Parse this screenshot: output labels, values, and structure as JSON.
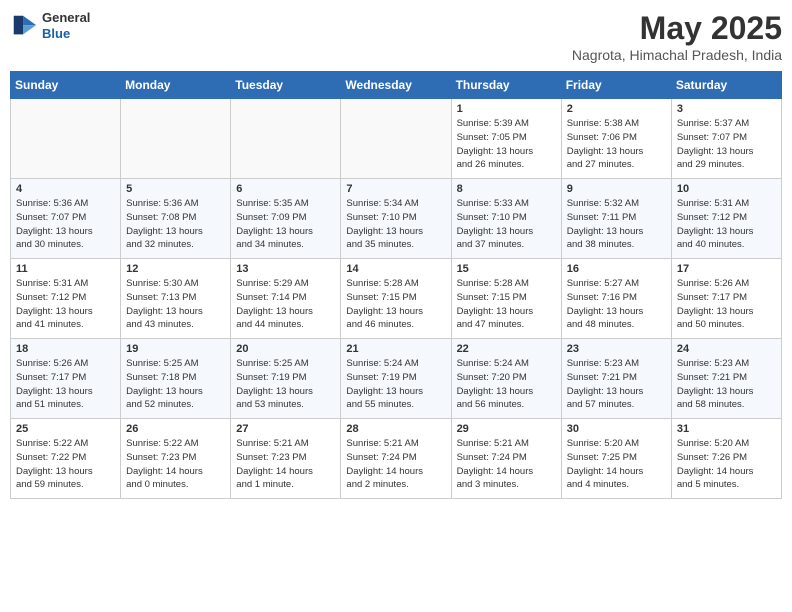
{
  "header": {
    "logo_general": "General",
    "logo_blue": "Blue",
    "month_title": "May 2025",
    "location": "Nagrota, Himachal Pradesh, India"
  },
  "weekdays": [
    "Sunday",
    "Monday",
    "Tuesday",
    "Wednesday",
    "Thursday",
    "Friday",
    "Saturday"
  ],
  "weeks": [
    [
      {
        "day": "",
        "info": ""
      },
      {
        "day": "",
        "info": ""
      },
      {
        "day": "",
        "info": ""
      },
      {
        "day": "",
        "info": ""
      },
      {
        "day": "1",
        "info": "Sunrise: 5:39 AM\nSunset: 7:05 PM\nDaylight: 13 hours\nand 26 minutes."
      },
      {
        "day": "2",
        "info": "Sunrise: 5:38 AM\nSunset: 7:06 PM\nDaylight: 13 hours\nand 27 minutes."
      },
      {
        "day": "3",
        "info": "Sunrise: 5:37 AM\nSunset: 7:07 PM\nDaylight: 13 hours\nand 29 minutes."
      }
    ],
    [
      {
        "day": "4",
        "info": "Sunrise: 5:36 AM\nSunset: 7:07 PM\nDaylight: 13 hours\nand 30 minutes."
      },
      {
        "day": "5",
        "info": "Sunrise: 5:36 AM\nSunset: 7:08 PM\nDaylight: 13 hours\nand 32 minutes."
      },
      {
        "day": "6",
        "info": "Sunrise: 5:35 AM\nSunset: 7:09 PM\nDaylight: 13 hours\nand 34 minutes."
      },
      {
        "day": "7",
        "info": "Sunrise: 5:34 AM\nSunset: 7:10 PM\nDaylight: 13 hours\nand 35 minutes."
      },
      {
        "day": "8",
        "info": "Sunrise: 5:33 AM\nSunset: 7:10 PM\nDaylight: 13 hours\nand 37 minutes."
      },
      {
        "day": "9",
        "info": "Sunrise: 5:32 AM\nSunset: 7:11 PM\nDaylight: 13 hours\nand 38 minutes."
      },
      {
        "day": "10",
        "info": "Sunrise: 5:31 AM\nSunset: 7:12 PM\nDaylight: 13 hours\nand 40 minutes."
      }
    ],
    [
      {
        "day": "11",
        "info": "Sunrise: 5:31 AM\nSunset: 7:12 PM\nDaylight: 13 hours\nand 41 minutes."
      },
      {
        "day": "12",
        "info": "Sunrise: 5:30 AM\nSunset: 7:13 PM\nDaylight: 13 hours\nand 43 minutes."
      },
      {
        "day": "13",
        "info": "Sunrise: 5:29 AM\nSunset: 7:14 PM\nDaylight: 13 hours\nand 44 minutes."
      },
      {
        "day": "14",
        "info": "Sunrise: 5:28 AM\nSunset: 7:15 PM\nDaylight: 13 hours\nand 46 minutes."
      },
      {
        "day": "15",
        "info": "Sunrise: 5:28 AM\nSunset: 7:15 PM\nDaylight: 13 hours\nand 47 minutes."
      },
      {
        "day": "16",
        "info": "Sunrise: 5:27 AM\nSunset: 7:16 PM\nDaylight: 13 hours\nand 48 minutes."
      },
      {
        "day": "17",
        "info": "Sunrise: 5:26 AM\nSunset: 7:17 PM\nDaylight: 13 hours\nand 50 minutes."
      }
    ],
    [
      {
        "day": "18",
        "info": "Sunrise: 5:26 AM\nSunset: 7:17 PM\nDaylight: 13 hours\nand 51 minutes."
      },
      {
        "day": "19",
        "info": "Sunrise: 5:25 AM\nSunset: 7:18 PM\nDaylight: 13 hours\nand 52 minutes."
      },
      {
        "day": "20",
        "info": "Sunrise: 5:25 AM\nSunset: 7:19 PM\nDaylight: 13 hours\nand 53 minutes."
      },
      {
        "day": "21",
        "info": "Sunrise: 5:24 AM\nSunset: 7:19 PM\nDaylight: 13 hours\nand 55 minutes."
      },
      {
        "day": "22",
        "info": "Sunrise: 5:24 AM\nSunset: 7:20 PM\nDaylight: 13 hours\nand 56 minutes."
      },
      {
        "day": "23",
        "info": "Sunrise: 5:23 AM\nSunset: 7:21 PM\nDaylight: 13 hours\nand 57 minutes."
      },
      {
        "day": "24",
        "info": "Sunrise: 5:23 AM\nSunset: 7:21 PM\nDaylight: 13 hours\nand 58 minutes."
      }
    ],
    [
      {
        "day": "25",
        "info": "Sunrise: 5:22 AM\nSunset: 7:22 PM\nDaylight: 13 hours\nand 59 minutes."
      },
      {
        "day": "26",
        "info": "Sunrise: 5:22 AM\nSunset: 7:23 PM\nDaylight: 14 hours\nand 0 minutes."
      },
      {
        "day": "27",
        "info": "Sunrise: 5:21 AM\nSunset: 7:23 PM\nDaylight: 14 hours\nand 1 minute."
      },
      {
        "day": "28",
        "info": "Sunrise: 5:21 AM\nSunset: 7:24 PM\nDaylight: 14 hours\nand 2 minutes."
      },
      {
        "day": "29",
        "info": "Sunrise: 5:21 AM\nSunset: 7:24 PM\nDaylight: 14 hours\nand 3 minutes."
      },
      {
        "day": "30",
        "info": "Sunrise: 5:20 AM\nSunset: 7:25 PM\nDaylight: 14 hours\nand 4 minutes."
      },
      {
        "day": "31",
        "info": "Sunrise: 5:20 AM\nSunset: 7:26 PM\nDaylight: 14 hours\nand 5 minutes."
      }
    ]
  ]
}
